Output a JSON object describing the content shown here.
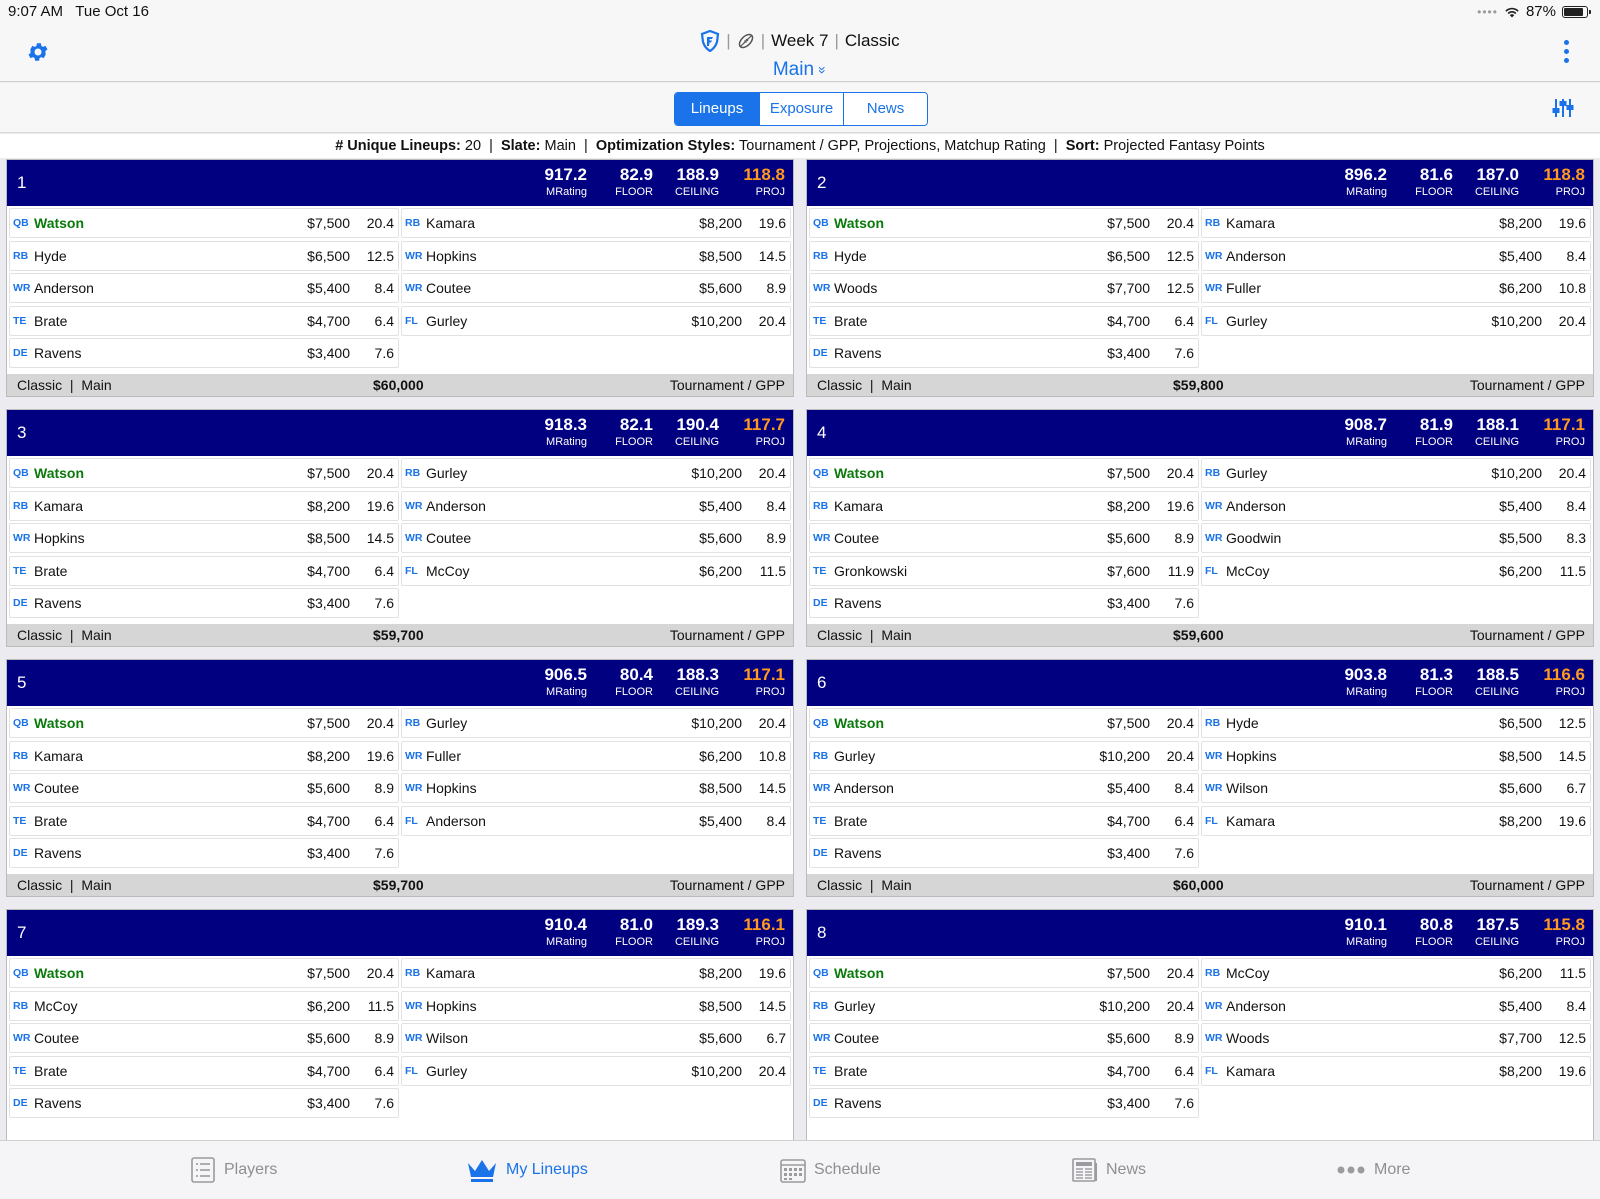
{
  "status": {
    "time": "9:07 AM",
    "date": "Tue Oct 16",
    "battery": "87%"
  },
  "header": {
    "week": "Week 7",
    "contest": "Classic",
    "slate": "Main",
    "slate_chevron": "»"
  },
  "segments": [
    "Lineups",
    "Exposure",
    "News"
  ],
  "summary": {
    "unique_label": "# Unique Lineups:",
    "unique_value": "20",
    "slate_label": "Slate:",
    "slate_value": "Main",
    "opt_label": "Optimization Styles:",
    "opt_value": "Tournament / GPP, Projections, Matchup Rating",
    "sort_label": "Sort:",
    "sort_value": "Projected Fantasy Points",
    "sep": "|"
  },
  "stat_labels": {
    "mrating": "MRating",
    "floor": "FLOOR",
    "ceiling": "CEILING",
    "proj": "PROJ"
  },
  "lineups": [
    {
      "num": "1",
      "mrating": "917.2",
      "floor": "82.9",
      "ceiling": "188.9",
      "proj": "118.8",
      "left": [
        [
          "QB",
          "Watson",
          "$7,500",
          "20.4"
        ],
        [
          "RB",
          "Hyde",
          "$6,500",
          "12.5"
        ],
        [
          "WR",
          "Anderson",
          "$5,400",
          "8.4"
        ],
        [
          "TE",
          "Brate",
          "$4,700",
          "6.4"
        ],
        [
          "DE",
          "Ravens",
          "$3,400",
          "7.6"
        ]
      ],
      "right": [
        [
          "RB",
          "Kamara",
          "$8,200",
          "19.6"
        ],
        [
          "WR",
          "Hopkins",
          "$8,500",
          "14.5"
        ],
        [
          "WR",
          "Coutee",
          "$5,600",
          "8.9"
        ],
        [
          "FL",
          "Gurley",
          "$10,200",
          "20.4"
        ]
      ],
      "type": "Classic  |  Main",
      "total": "$60,000",
      "style": "Tournament / GPP"
    },
    {
      "num": "2",
      "mrating": "896.2",
      "floor": "81.6",
      "ceiling": "187.0",
      "proj": "118.8",
      "left": [
        [
          "QB",
          "Watson",
          "$7,500",
          "20.4"
        ],
        [
          "RB",
          "Hyde",
          "$6,500",
          "12.5"
        ],
        [
          "WR",
          "Woods",
          "$7,700",
          "12.5"
        ],
        [
          "TE",
          "Brate",
          "$4,700",
          "6.4"
        ],
        [
          "DE",
          "Ravens",
          "$3,400",
          "7.6"
        ]
      ],
      "right": [
        [
          "RB",
          "Kamara",
          "$8,200",
          "19.6"
        ],
        [
          "WR",
          "Anderson",
          "$5,400",
          "8.4"
        ],
        [
          "WR",
          "Fuller",
          "$6,200",
          "10.8"
        ],
        [
          "FL",
          "Gurley",
          "$10,200",
          "20.4"
        ]
      ],
      "type": "Classic  |  Main",
      "total": "$59,800",
      "style": "Tournament / GPP"
    },
    {
      "num": "3",
      "mrating": "918.3",
      "floor": "82.1",
      "ceiling": "190.4",
      "proj": "117.7",
      "left": [
        [
          "QB",
          "Watson",
          "$7,500",
          "20.4"
        ],
        [
          "RB",
          "Kamara",
          "$8,200",
          "19.6"
        ],
        [
          "WR",
          "Hopkins",
          "$8,500",
          "14.5"
        ],
        [
          "TE",
          "Brate",
          "$4,700",
          "6.4"
        ],
        [
          "DE",
          "Ravens",
          "$3,400",
          "7.6"
        ]
      ],
      "right": [
        [
          "RB",
          "Gurley",
          "$10,200",
          "20.4"
        ],
        [
          "WR",
          "Anderson",
          "$5,400",
          "8.4"
        ],
        [
          "WR",
          "Coutee",
          "$5,600",
          "8.9"
        ],
        [
          "FL",
          "McCoy",
          "$6,200",
          "11.5"
        ]
      ],
      "type": "Classic  |  Main",
      "total": "$59,700",
      "style": "Tournament / GPP"
    },
    {
      "num": "4",
      "mrating": "908.7",
      "floor": "81.9",
      "ceiling": "188.1",
      "proj": "117.1",
      "left": [
        [
          "QB",
          "Watson",
          "$7,500",
          "20.4"
        ],
        [
          "RB",
          "Kamara",
          "$8,200",
          "19.6"
        ],
        [
          "WR",
          "Coutee",
          "$5,600",
          "8.9"
        ],
        [
          "TE",
          "Gronkowski",
          "$7,600",
          "11.9"
        ],
        [
          "DE",
          "Ravens",
          "$3,400",
          "7.6"
        ]
      ],
      "right": [
        [
          "RB",
          "Gurley",
          "$10,200",
          "20.4"
        ],
        [
          "WR",
          "Anderson",
          "$5,400",
          "8.4"
        ],
        [
          "WR",
          "Goodwin",
          "$5,500",
          "8.3"
        ],
        [
          "FL",
          "McCoy",
          "$6,200",
          "11.5"
        ]
      ],
      "type": "Classic  |  Main",
      "total": "$59,600",
      "style": "Tournament / GPP"
    },
    {
      "num": "5",
      "mrating": "906.5",
      "floor": "80.4",
      "ceiling": "188.3",
      "proj": "117.1",
      "left": [
        [
          "QB",
          "Watson",
          "$7,500",
          "20.4"
        ],
        [
          "RB",
          "Kamara",
          "$8,200",
          "19.6"
        ],
        [
          "WR",
          "Coutee",
          "$5,600",
          "8.9"
        ],
        [
          "TE",
          "Brate",
          "$4,700",
          "6.4"
        ],
        [
          "DE",
          "Ravens",
          "$3,400",
          "7.6"
        ]
      ],
      "right": [
        [
          "RB",
          "Gurley",
          "$10,200",
          "20.4"
        ],
        [
          "WR",
          "Fuller",
          "$6,200",
          "10.8"
        ],
        [
          "WR",
          "Hopkins",
          "$8,500",
          "14.5"
        ],
        [
          "FL",
          "Anderson",
          "$5,400",
          "8.4"
        ]
      ],
      "type": "Classic  |  Main",
      "total": "$59,700",
      "style": "Tournament / GPP"
    },
    {
      "num": "6",
      "mrating": "903.8",
      "floor": "81.3",
      "ceiling": "188.5",
      "proj": "116.6",
      "left": [
        [
          "QB",
          "Watson",
          "$7,500",
          "20.4"
        ],
        [
          "RB",
          "Gurley",
          "$10,200",
          "20.4"
        ],
        [
          "WR",
          "Anderson",
          "$5,400",
          "8.4"
        ],
        [
          "TE",
          "Brate",
          "$4,700",
          "6.4"
        ],
        [
          "DE",
          "Ravens",
          "$3,400",
          "7.6"
        ]
      ],
      "right": [
        [
          "RB",
          "Hyde",
          "$6,500",
          "12.5"
        ],
        [
          "WR",
          "Hopkins",
          "$8,500",
          "14.5"
        ],
        [
          "WR",
          "Wilson",
          "$5,600",
          "6.7"
        ],
        [
          "FL",
          "Kamara",
          "$8,200",
          "19.6"
        ]
      ],
      "type": "Classic  |  Main",
      "total": "$60,000",
      "style": "Tournament / GPP"
    },
    {
      "num": "7",
      "mrating": "910.4",
      "floor": "81.0",
      "ceiling": "189.3",
      "proj": "116.1",
      "left": [
        [
          "QB",
          "Watson",
          "$7,500",
          "20.4"
        ],
        [
          "RB",
          "McCoy",
          "$6,200",
          "11.5"
        ],
        [
          "WR",
          "Coutee",
          "$5,600",
          "8.9"
        ],
        [
          "TE",
          "Brate",
          "$4,700",
          "6.4"
        ],
        [
          "DE",
          "Ravens",
          "$3,400",
          "7.6"
        ]
      ],
      "right": [
        [
          "RB",
          "Kamara",
          "$8,200",
          "19.6"
        ],
        [
          "WR",
          "Hopkins",
          "$8,500",
          "14.5"
        ],
        [
          "WR",
          "Wilson",
          "$5,600",
          "6.7"
        ],
        [
          "FL",
          "Gurley",
          "$10,200",
          "20.4"
        ]
      ],
      "type": "",
      "total": "",
      "style": ""
    },
    {
      "num": "8",
      "mrating": "910.1",
      "floor": "80.8",
      "ceiling": "187.5",
      "proj": "115.8",
      "left": [
        [
          "QB",
          "Watson",
          "$7,500",
          "20.4"
        ],
        [
          "RB",
          "Gurley",
          "$10,200",
          "20.4"
        ],
        [
          "WR",
          "Coutee",
          "$5,600",
          "8.9"
        ],
        [
          "TE",
          "Brate",
          "$4,700",
          "6.4"
        ],
        [
          "DE",
          "Ravens",
          "$3,400",
          "7.6"
        ]
      ],
      "right": [
        [
          "RB",
          "McCoy",
          "$6,200",
          "11.5"
        ],
        [
          "WR",
          "Anderson",
          "$5,400",
          "8.4"
        ],
        [
          "WR",
          "Woods",
          "$7,700",
          "12.5"
        ],
        [
          "FL",
          "Kamara",
          "$8,200",
          "19.6"
        ]
      ],
      "type": "",
      "total": "",
      "style": ""
    }
  ],
  "tabs": [
    {
      "label": "Players",
      "icon": "list-icon"
    },
    {
      "label": "My Lineups",
      "icon": "crown-icon"
    },
    {
      "label": "Schedule",
      "icon": "calendar-icon"
    },
    {
      "label": "News",
      "icon": "newspaper-icon"
    },
    {
      "label": "More",
      "icon": "more-dots-icon"
    }
  ],
  "colors": {
    "accent": "#1a73e8",
    "card_header": "#000080",
    "proj": "#ff9a1f",
    "qb_name": "#0a7a0a"
  }
}
